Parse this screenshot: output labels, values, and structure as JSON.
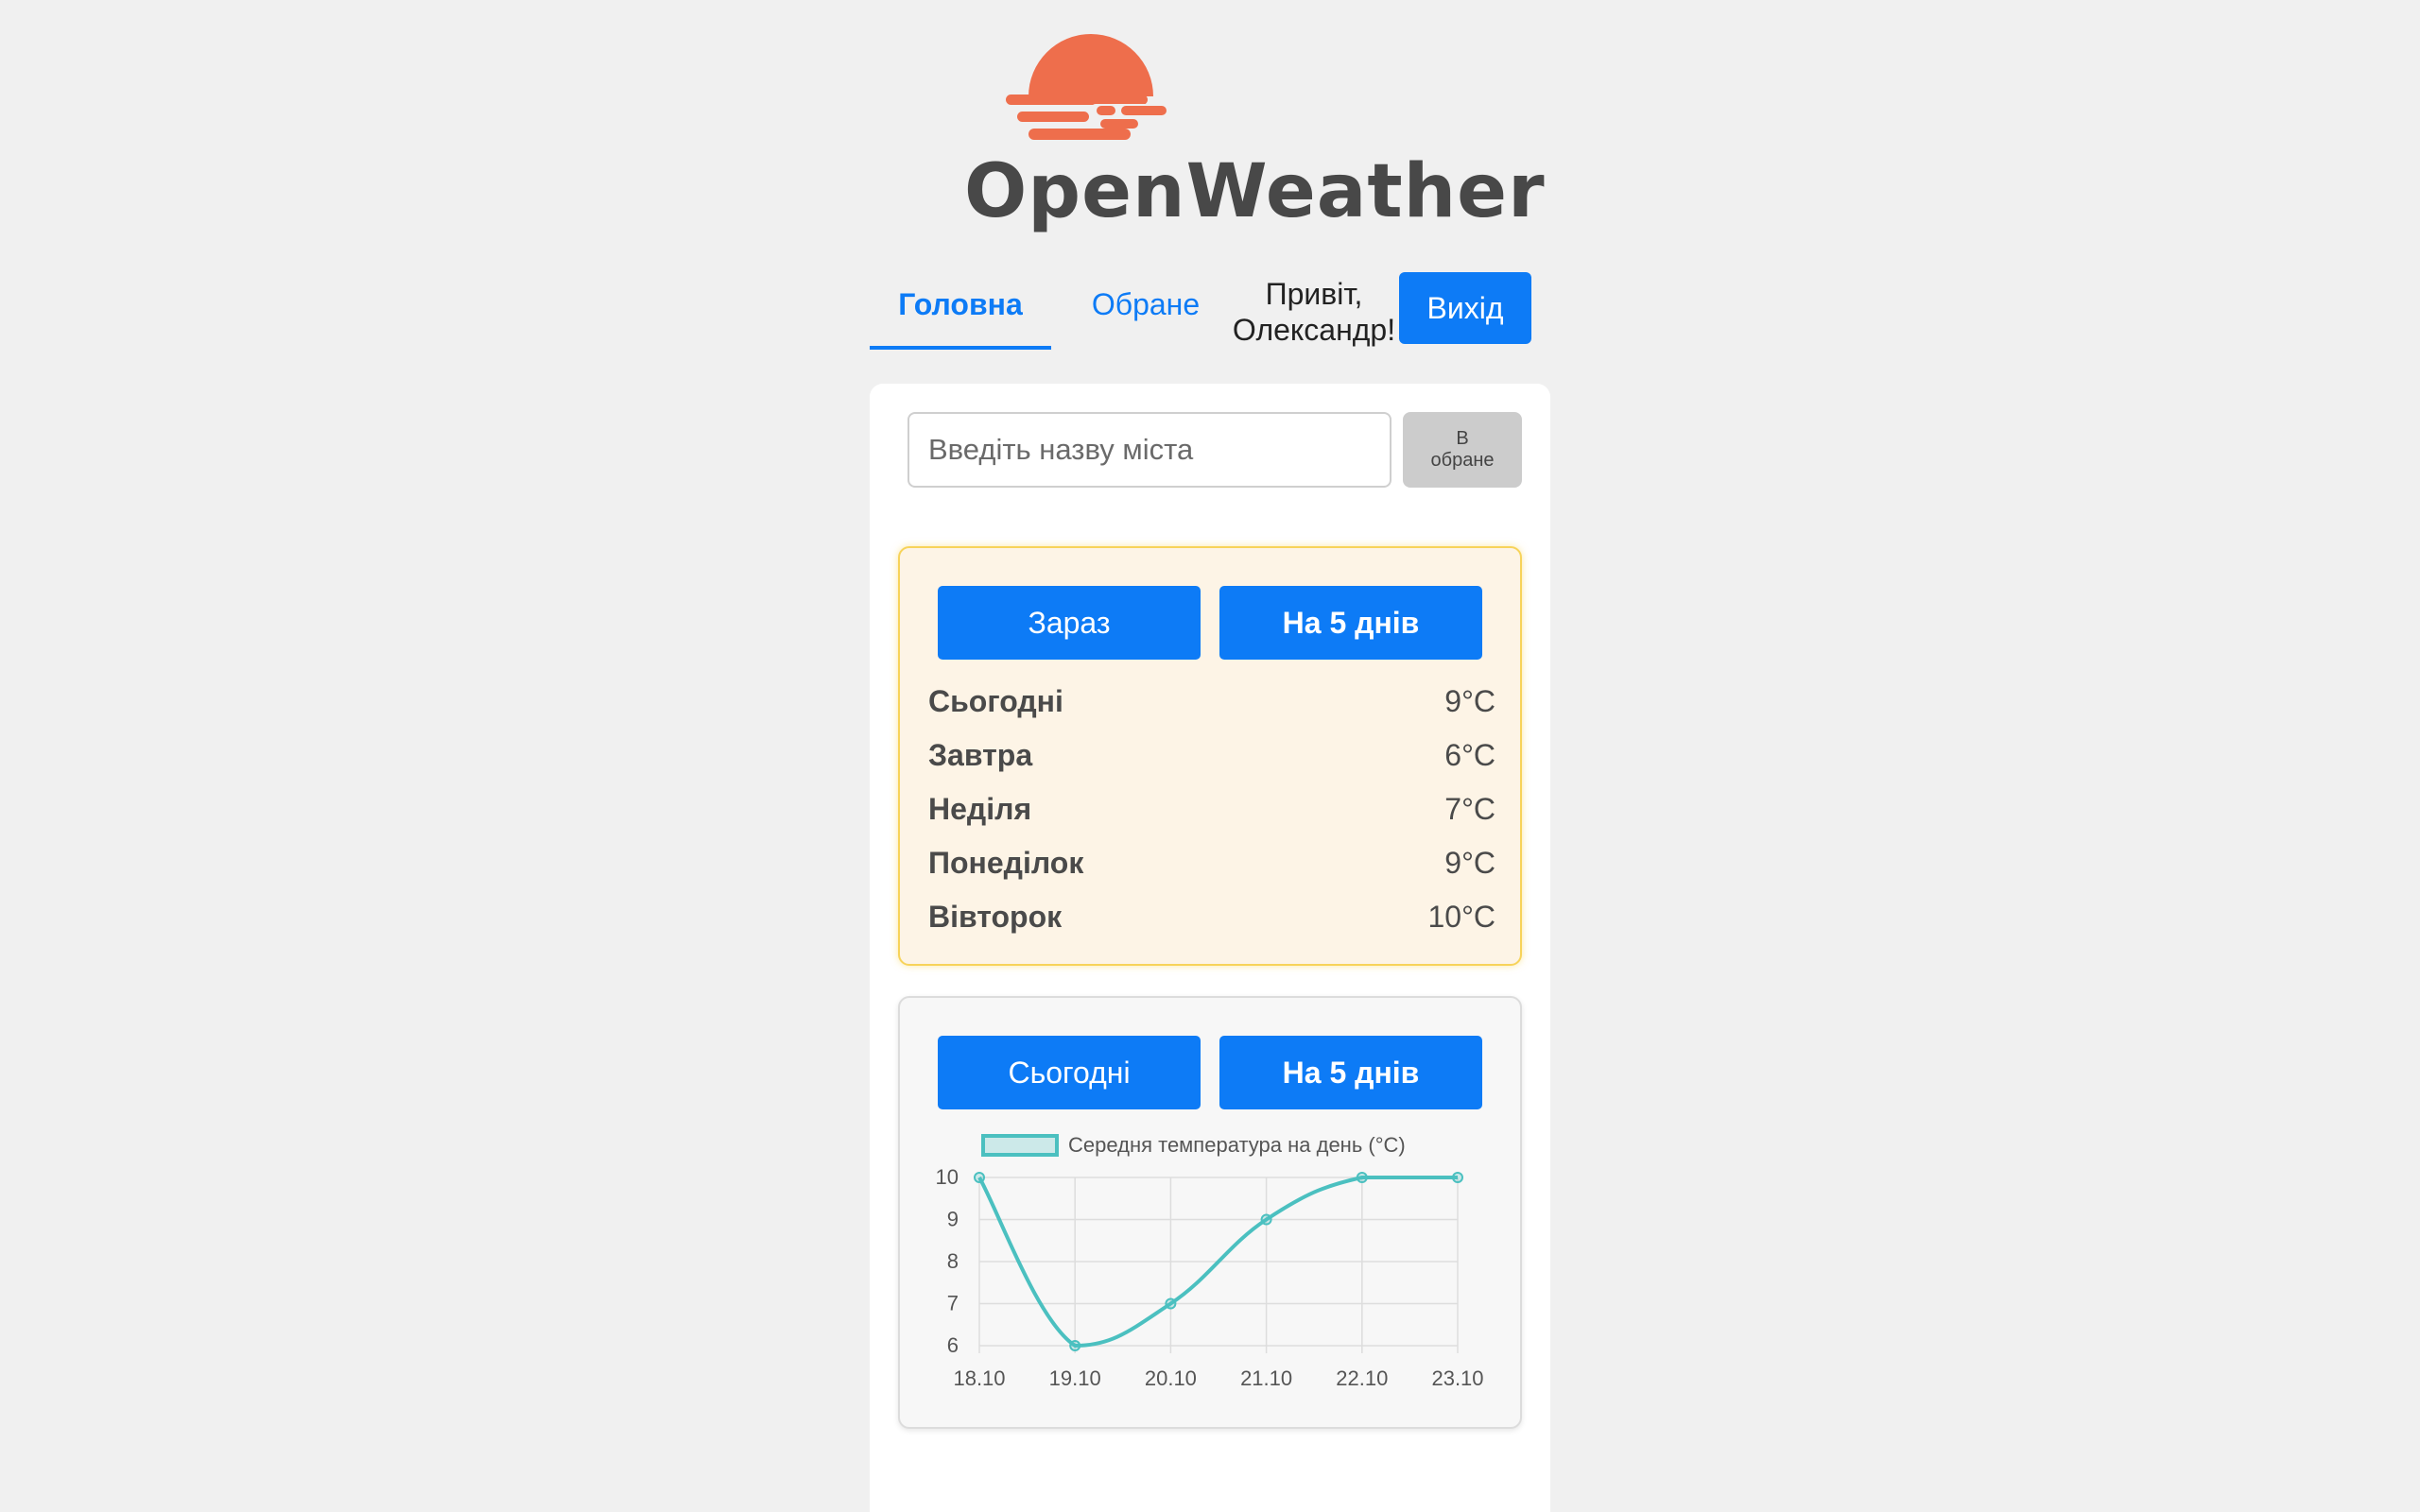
{
  "brand": {
    "name": "OpenWeather"
  },
  "nav": {
    "tabs": [
      {
        "label": "Головна",
        "active": true
      },
      {
        "label": "Обране",
        "active": false
      }
    ],
    "greeting": "Привіт, Олександр!",
    "logout_label": "Вихід"
  },
  "search": {
    "placeholder": "Введіть назву міста",
    "favorite_button_label": "В обране"
  },
  "forecast": {
    "buttons": {
      "now": "Зараз",
      "five_days": "На 5 днів"
    },
    "days": [
      {
        "name": "Сьогодні",
        "temp": "9°C"
      },
      {
        "name": "Завтра",
        "temp": "6°C"
      },
      {
        "name": "Неділя",
        "temp": "7°C"
      },
      {
        "name": "Понеділок",
        "temp": "9°C"
      },
      {
        "name": "Вівторок",
        "temp": "10°C"
      }
    ]
  },
  "chart_panel": {
    "buttons": {
      "today": "Сьогодні",
      "five_days": "На 5 днів"
    }
  },
  "colors": {
    "accent": "#0d7bf6",
    "logo": "#ee6e4c",
    "line": "#4bc0c0",
    "forecast_bg": "#fdf4e6",
    "forecast_border": "#f7d35a"
  },
  "chart_data": {
    "type": "line",
    "x": [
      "18.10",
      "19.10",
      "20.10",
      "21.10",
      "22.10",
      "23.10"
    ],
    "series": [
      {
        "name": "Середня температура на день (°C)",
        "values": [
          10,
          6,
          7,
          9,
          10,
          10
        ]
      }
    ],
    "y_ticks": [
      10,
      9,
      8,
      7,
      6
    ],
    "ylim": [
      6,
      10
    ],
    "grid": true,
    "legend": "top"
  }
}
